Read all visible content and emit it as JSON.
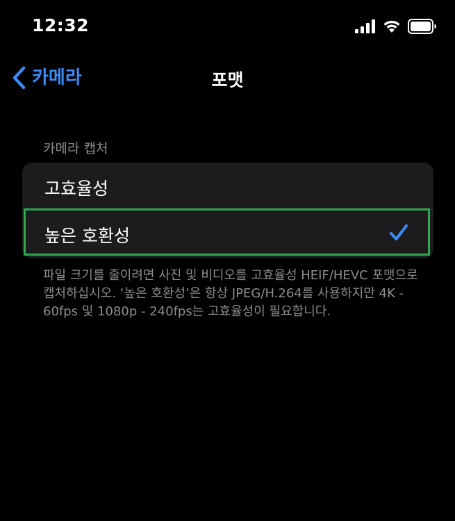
{
  "status_bar": {
    "time": "12:32",
    "icons": [
      "cellular-signal-icon",
      "wifi-icon",
      "battery-icon"
    ]
  },
  "nav": {
    "back_label": "카메라",
    "title": "포맷"
  },
  "section": {
    "header": "카메라 캡처",
    "options": [
      {
        "label": "고효율성",
        "selected": false
      },
      {
        "label": "높은 호환성",
        "selected": true
      }
    ],
    "footer": "파일 크기를 줄이려면 사진 및 비디오를 고효율성 HEIF/HEVC 포맷으로 캡처하십시오. ‘높은 호환성’은 항상 JPEG/H.264를 사용하지만 4K - 60fps 및 1080p - 240fps는 고효율성이 필요합니다."
  },
  "colors": {
    "background": "#000000",
    "group_background": "#1c1c1e",
    "accent": "#3b8bf7",
    "secondary_text": "#8e8e93",
    "highlight_border": "#2fa84f"
  }
}
